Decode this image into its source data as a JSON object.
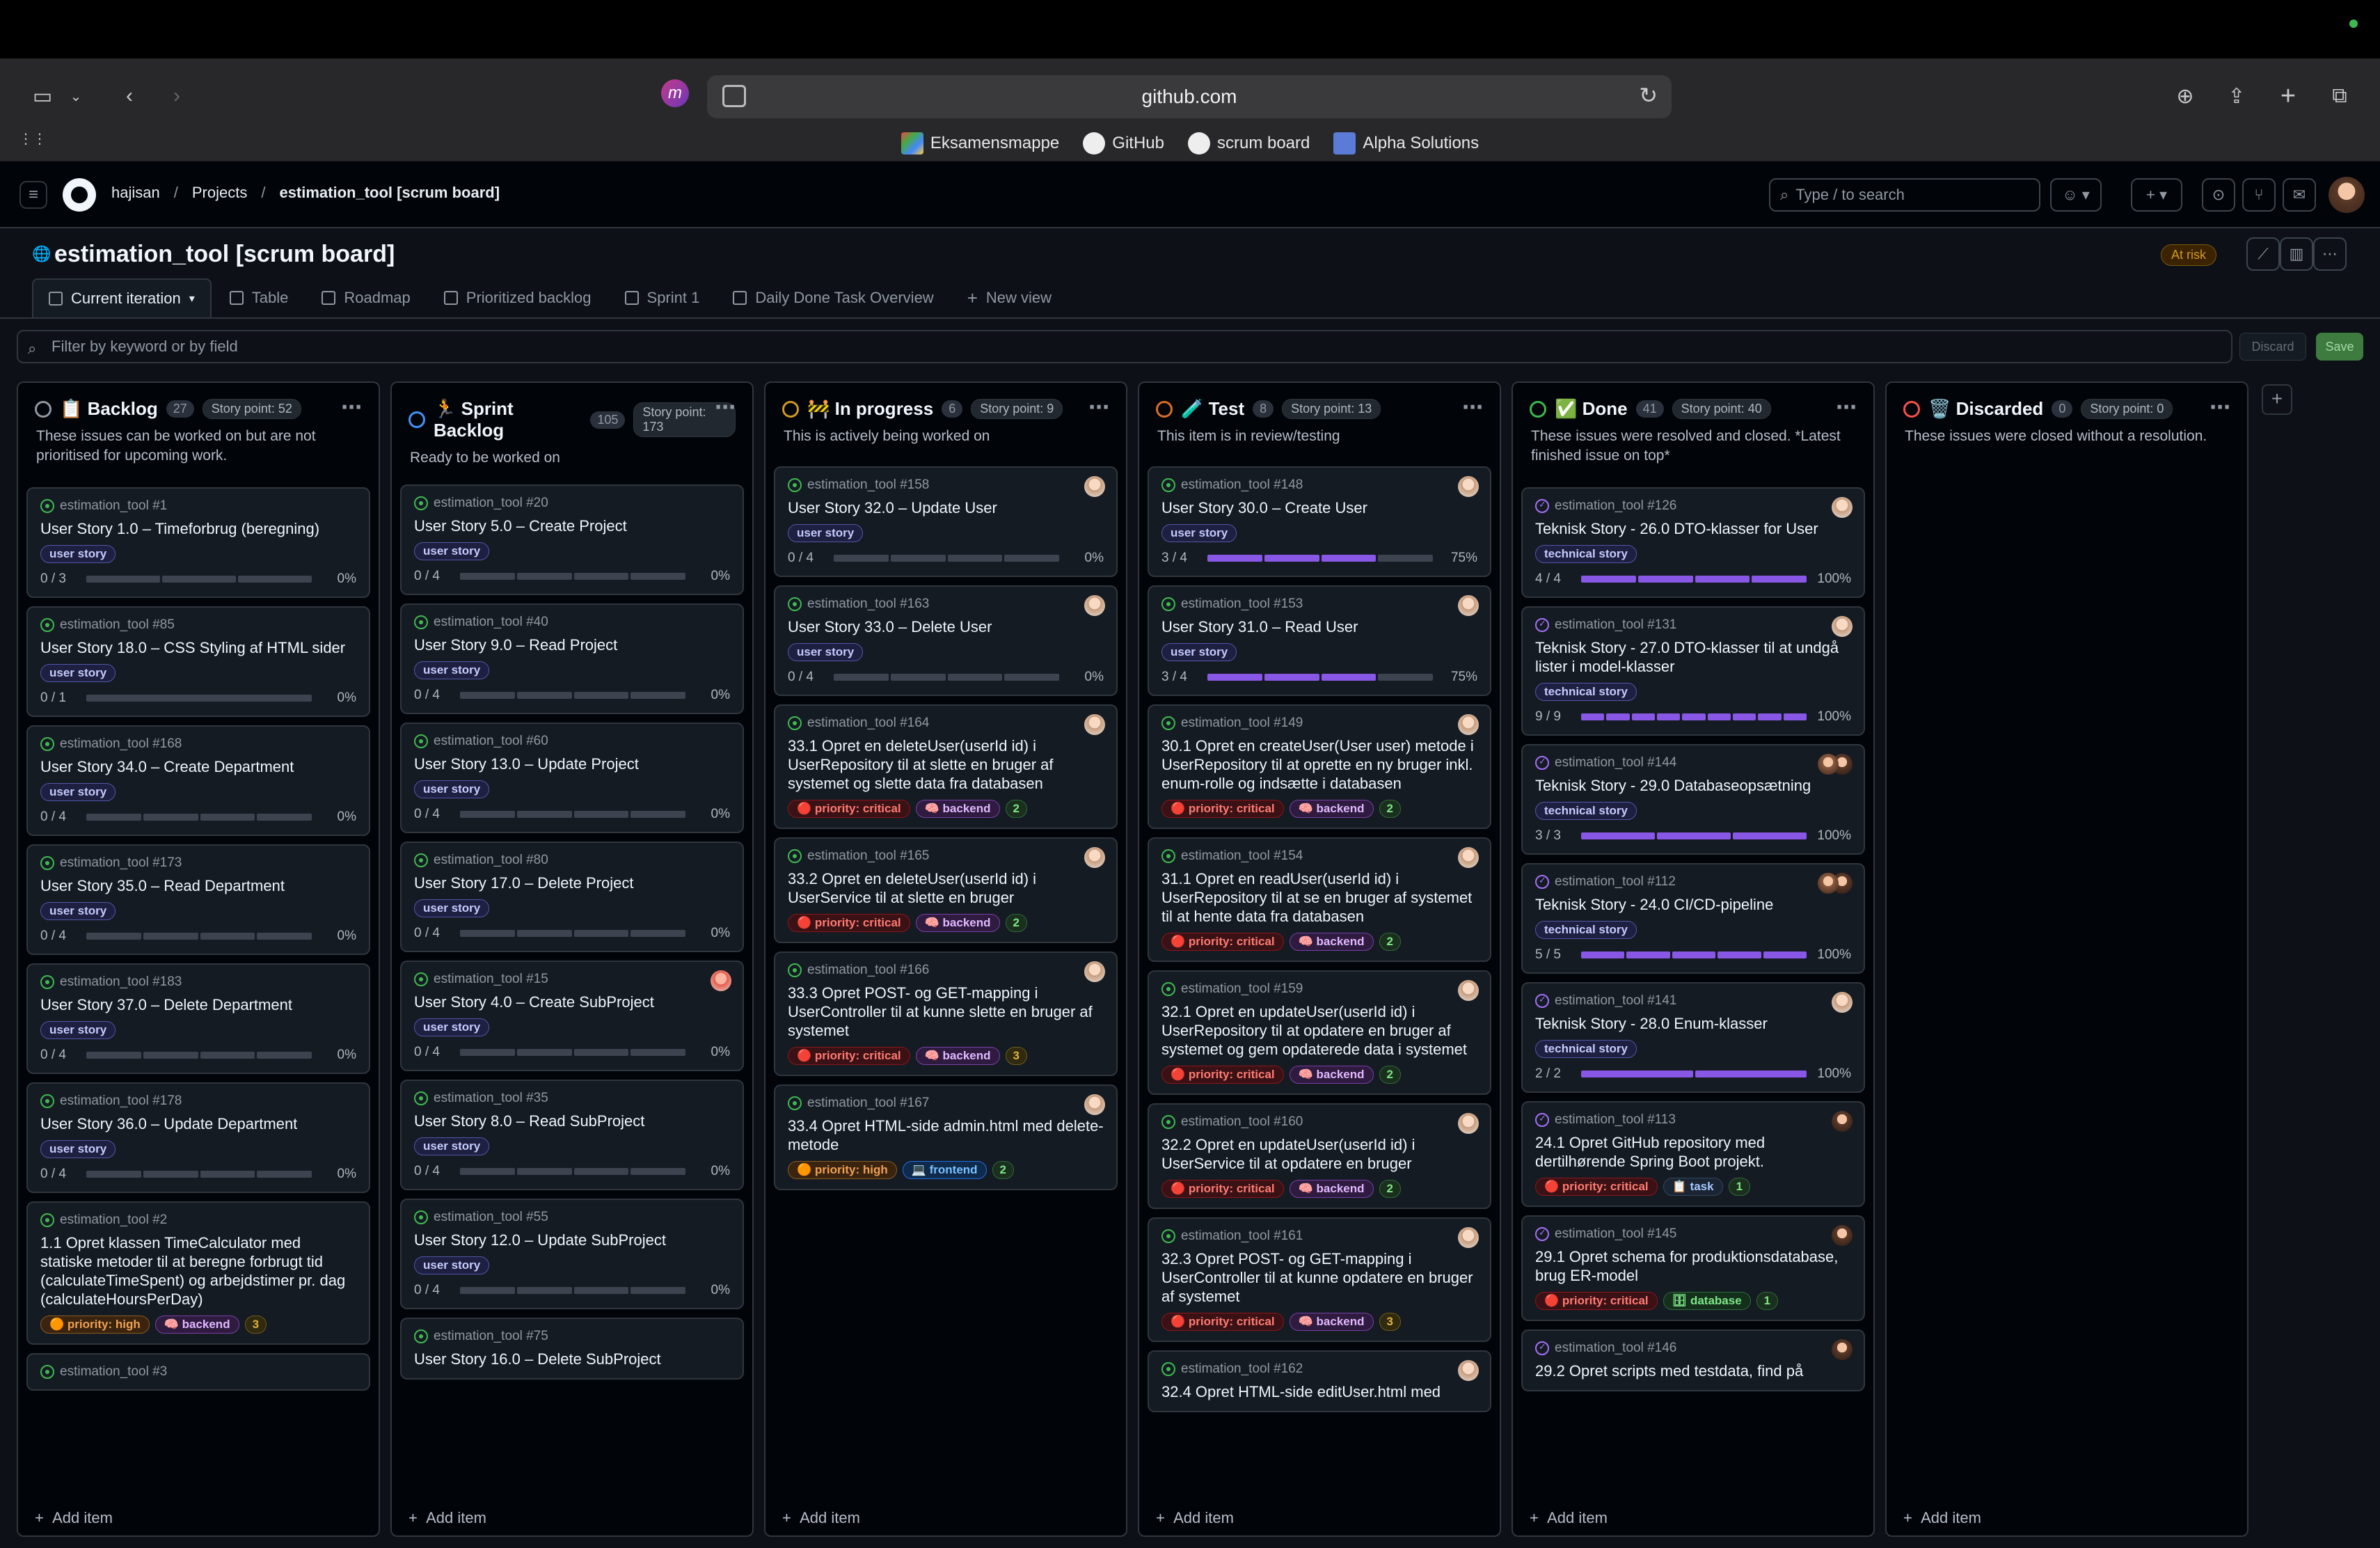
{
  "browser": {
    "url": "github.com",
    "bookmarks": [
      "Eksamensmappe",
      "GitHub",
      "scrum board",
      "Alpha Solutions"
    ]
  },
  "header": {
    "breadcrumbs": [
      "hajisan",
      "Projects",
      "estimation_tool [scrum board]"
    ],
    "search_text": "Type / to search"
  },
  "project": {
    "title": "estimation_tool [scrum board]",
    "status": "At risk",
    "tabs": [
      "Current iteration",
      "Table",
      "Roadmap",
      "Prioritized backlog",
      "Sprint 1",
      "Daily Done Task Overview"
    ],
    "new_view": "New view",
    "filter_placeholder": "Filter by keyword or by field",
    "discard": "Discard",
    "save": "Save",
    "add_item": "Add item"
  },
  "columns": [
    {
      "name": "📋 Backlog",
      "count": "27",
      "story_point": "Story point: 52",
      "color": "#9198a1",
      "desc": "These issues can be worked on but are not prioritised for upcoming work.",
      "cards": [
        {
          "ref": "estimation_tool #1",
          "title": "User Story 1.0 – Timeforbrug (beregning)",
          "labels": [
            [
              "user story",
              "us"
            ]
          ],
          "done": 0,
          "total": 3,
          "pct": "0%"
        },
        {
          "ref": "estimation_tool #85",
          "title": "User Story 18.0 – CSS Styling af HTML sider",
          "labels": [
            [
              "user story",
              "us"
            ]
          ],
          "done": 0,
          "total": 1,
          "pct": "0%"
        },
        {
          "ref": "estimation_tool #168",
          "title": "User Story 34.0 – Create Department",
          "labels": [
            [
              "user story",
              "us"
            ]
          ],
          "done": 0,
          "total": 4,
          "pct": "0%"
        },
        {
          "ref": "estimation_tool #173",
          "title": "User Story 35.0 – Read Department",
          "labels": [
            [
              "user story",
              "us"
            ]
          ],
          "done": 0,
          "total": 4,
          "pct": "0%"
        },
        {
          "ref": "estimation_tool #183",
          "title": "User Story 37.0 – Delete Department",
          "labels": [
            [
              "user story",
              "us"
            ]
          ],
          "done": 0,
          "total": 4,
          "pct": "0%"
        },
        {
          "ref": "estimation_tool #178",
          "title": "User Story 36.0 – Update Department",
          "labels": [
            [
              "user story",
              "us"
            ]
          ],
          "done": 0,
          "total": 4,
          "pct": "0%"
        },
        {
          "ref": "estimation_tool #2",
          "title": "1.1 Opret klassen TimeCalculator med statiske metoder til at beregne forbrugt tid (calculateTimeSpent) og arbejdstimer pr. dag (calculateHoursPerDay)",
          "labels": [
            [
              "🟠 priority: high",
              "high"
            ],
            [
              "🧠 backend",
              "be"
            ],
            [
              "3",
              "num y"
            ]
          ]
        },
        {
          "ref": "estimation_tool #3",
          "title": "",
          "labels": []
        }
      ]
    },
    {
      "name": "🏃 Sprint Backlog",
      "count": "105",
      "story_point": "Story point: 173",
      "color": "#4493f8",
      "desc": "Ready to be worked on",
      "cards": [
        {
          "ref": "estimation_tool #20",
          "title": "User Story 5.0 – Create Project",
          "labels": [
            [
              "user story",
              "us"
            ]
          ],
          "done": 0,
          "total": 4,
          "pct": "0%"
        },
        {
          "ref": "estimation_tool #40",
          "title": "User Story 9.0 – Read Project",
          "labels": [
            [
              "user story",
              "us"
            ]
          ],
          "done": 0,
          "total": 4,
          "pct": "0%"
        },
        {
          "ref": "estimation_tool #60",
          "title": "User Story 13.0 – Update Project",
          "labels": [
            [
              "user story",
              "us"
            ]
          ],
          "done": 0,
          "total": 4,
          "pct": "0%"
        },
        {
          "ref": "estimation_tool #80",
          "title": "User Story 17.0 – Delete Project",
          "labels": [
            [
              "user story",
              "us"
            ]
          ],
          "done": 0,
          "total": 4,
          "pct": "0%"
        },
        {
          "ref": "estimation_tool #15",
          "title": "User Story 4.0 – Create SubProject",
          "labels": [
            [
              "user story",
              "us"
            ]
          ],
          "done": 0,
          "total": 4,
          "pct": "0%",
          "avatar": "p"
        },
        {
          "ref": "estimation_tool #35",
          "title": "User Story 8.0 – Read SubProject",
          "labels": [
            [
              "user story",
              "us"
            ]
          ],
          "done": 0,
          "total": 4,
          "pct": "0%"
        },
        {
          "ref": "estimation_tool #55",
          "title": "User Story 12.0 – Update SubProject",
          "labels": [
            [
              "user story",
              "us"
            ]
          ],
          "done": 0,
          "total": 4,
          "pct": "0%"
        },
        {
          "ref": "estimation_tool #75",
          "title": "User Story 16.0 – Delete SubProject",
          "labels": []
        }
      ]
    },
    {
      "name": "🚧 In progress",
      "count": "6",
      "story_point": "Story point: 9",
      "color": "#d29922",
      "desc": "This is actively being worked on",
      "cards": [
        {
          "ref": "estimation_tool #158",
          "title": "User Story 32.0 – Update User",
          "labels": [
            [
              "user story",
              "us"
            ]
          ],
          "done": 0,
          "total": 4,
          "pct": "0%",
          "avatar": "a"
        },
        {
          "ref": "estimation_tool #163",
          "title": "User Story 33.0 – Delete User",
          "labels": [
            [
              "user story",
              "us"
            ]
          ],
          "done": 0,
          "total": 4,
          "pct": "0%",
          "avatar": "a"
        },
        {
          "ref": "estimation_tool #164",
          "title": "33.1 Opret en deleteUser(userId id) i UserRepository til at slette en bruger af systemet og slette data fra databasen",
          "labels": [
            [
              "🔴 priority: critical",
              "crit"
            ],
            [
              "🧠 backend",
              "be"
            ],
            [
              "2",
              "num"
            ]
          ],
          "avatar": "a"
        },
        {
          "ref": "estimation_tool #165",
          "title": "33.2 Opret en deleteUser(userId id) i UserService til at slette en bruger",
          "labels": [
            [
              "🔴 priority: critical",
              "crit"
            ],
            [
              "🧠 backend",
              "be"
            ],
            [
              "2",
              "num"
            ]
          ],
          "avatar": "a"
        },
        {
          "ref": "estimation_tool #166",
          "title": "33.3 Opret POST- og GET-mapping i UserController til at kunne slette en bruger af systemet",
          "labels": [
            [
              "🔴 priority: critical",
              "crit"
            ],
            [
              "🧠 backend",
              "be"
            ],
            [
              "3",
              "num y"
            ]
          ],
          "avatar": "a"
        },
        {
          "ref": "estimation_tool #167",
          "title": "33.4 Opret HTML-side admin.html med delete-metode",
          "labels": [
            [
              "🟠 priority: high",
              "high"
            ],
            [
              "💻 frontend",
              "fe"
            ],
            [
              "2",
              "num"
            ]
          ],
          "avatar": "a"
        }
      ]
    },
    {
      "name": "🧪 Test",
      "count": "8",
      "story_point": "Story point: 13",
      "color": "#db6d28",
      "desc": "This item is in review/testing",
      "cards": [
        {
          "ref": "estimation_tool #148",
          "title": "User Story 30.0 – Create User",
          "labels": [
            [
              "user story",
              "us"
            ]
          ],
          "done": 3,
          "total": 4,
          "pct": "75%",
          "avatar": "a"
        },
        {
          "ref": "estimation_tool #153",
          "title": "User Story 31.0 – Read User",
          "labels": [
            [
              "user story",
              "us"
            ]
          ],
          "done": 3,
          "total": 4,
          "pct": "75%",
          "avatar": "a"
        },
        {
          "ref": "estimation_tool #149",
          "title": "30.1 Opret en createUser(User user) metode i UserRepository til at oprette en ny bruger inkl. enum-rolle og indsætte i databasen",
          "labels": [
            [
              "🔴 priority: critical",
              "crit"
            ],
            [
              "🧠 backend",
              "be"
            ],
            [
              "2",
              "num"
            ]
          ],
          "avatar": "a"
        },
        {
          "ref": "estimation_tool #154",
          "title": "31.1 Opret en readUser(userId id) i UserRepository til at se en bruger af systemet til at hente data fra databasen",
          "labels": [
            [
              "🔴 priority: critical",
              "crit"
            ],
            [
              "🧠 backend",
              "be"
            ],
            [
              "2",
              "num"
            ]
          ],
          "avatar": "a"
        },
        {
          "ref": "estimation_tool #159",
          "title": "32.1 Opret en updateUser(userId id) i UserRepository til at opdatere en bruger af systemet og gem opdaterede data i systemet",
          "labels": [
            [
              "🔴 priority: critical",
              "crit"
            ],
            [
              "🧠 backend",
              "be"
            ],
            [
              "2",
              "num"
            ]
          ],
          "avatar": "a"
        },
        {
          "ref": "estimation_tool #160",
          "title": "32.2 Opret en updateUser(userId id) i UserService til at opdatere en bruger",
          "labels": [
            [
              "🔴 priority: critical",
              "crit"
            ],
            [
              "🧠 backend",
              "be"
            ],
            [
              "2",
              "num"
            ]
          ],
          "avatar": "a"
        },
        {
          "ref": "estimation_tool #161",
          "title": "32.3 Opret POST- og GET-mapping i UserController til at kunne opdatere en bruger af systemet",
          "labels": [
            [
              "🔴 priority: critical",
              "crit"
            ],
            [
              "🧠 backend",
              "be"
            ],
            [
              "3",
              "num y"
            ]
          ],
          "avatar": "a"
        },
        {
          "ref": "estimation_tool #162",
          "title": "32.4 Opret HTML-side editUser.html med",
          "labels": [],
          "avatar": "a"
        }
      ]
    },
    {
      "name": "✅ Done",
      "count": "41",
      "story_point": "Story point: 40",
      "color": "#3fb950",
      "desc": "These issues were resolved and closed. *Latest finished issue on top*",
      "cards": [
        {
          "ref": "estimation_tool #126",
          "title": "Teknisk Story - 26.0 DTO-klasser for User",
          "labels": [
            [
              "technical story",
              "ts"
            ]
          ],
          "done": 4,
          "total": 4,
          "pct": "100%",
          "avatar": "a",
          "closed": true
        },
        {
          "ref": "estimation_tool #131",
          "title": "Teknisk Story - 27.0 DTO-klasser til at undgå lister i model-klasser",
          "labels": [
            [
              "technical story",
              "ts"
            ]
          ],
          "done": 9,
          "total": 9,
          "pct": "100%",
          "avatar": "a",
          "closed": true
        },
        {
          "ref": "estimation_tool #144",
          "title": "Teknisk Story - 29.0 Databaseopsætning",
          "labels": [
            [
              "technical story",
              "ts"
            ]
          ],
          "done": 3,
          "total": 3,
          "pct": "100%",
          "avatar": "b",
          "second": true,
          "closed": true
        },
        {
          "ref": "estimation_tool #112",
          "title": "Teknisk Story - 24.0 CI/CD-pipeline",
          "labels": [
            [
              "technical story",
              "ts"
            ]
          ],
          "done": 5,
          "total": 5,
          "pct": "100%",
          "avatar": "b",
          "second": true,
          "closed": true
        },
        {
          "ref": "estimation_tool #141",
          "title": "Teknisk Story - 28.0 Enum-klasser",
          "labels": [
            [
              "technical story",
              "ts"
            ]
          ],
          "done": 2,
          "total": 2,
          "pct": "100%",
          "avatar": "a",
          "closed": true
        },
        {
          "ref": "estimation_tool #113",
          "title": "24.1 Opret GitHub repository med dertilhørende Spring Boot projekt.",
          "labels": [
            [
              "🔴 priority: critical",
              "crit"
            ],
            [
              "📋 task",
              "task"
            ],
            [
              "1",
              "num"
            ]
          ],
          "avatar": "b",
          "closed": true
        },
        {
          "ref": "estimation_tool #145",
          "title": "29.1 Opret schema for produktionsdatabase, brug ER-model",
          "labels": [
            [
              "🔴 priority: critical",
              "crit"
            ],
            [
              "🗄 database",
              "db"
            ],
            [
              "1",
              "num"
            ]
          ],
          "avatar": "b",
          "closed": true
        },
        {
          "ref": "estimation_tool #146",
          "title": "29.2 Opret scripts med testdata, find på",
          "labels": [],
          "avatar": "b",
          "closed": true
        }
      ]
    },
    {
      "name": "🗑️ Discarded",
      "count": "0",
      "story_point": "Story point: 0",
      "color": "#f85149",
      "desc": "These issues were closed without a resolution.",
      "cards": []
    }
  ]
}
